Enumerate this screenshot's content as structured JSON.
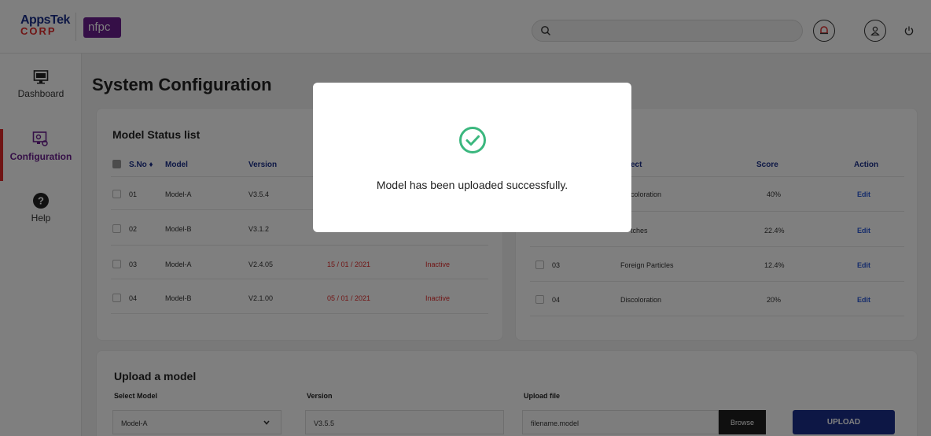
{
  "header": {
    "brand_line1": "AppsTek",
    "brand_line2": "CORP",
    "partner_logo": "nfpc",
    "search_icon": "search-icon",
    "icons": [
      "notification-icon",
      "user-icon",
      "power-icon"
    ]
  },
  "sidebar": {
    "items": [
      {
        "label": "Dashboard",
        "icon": "monitor-icon"
      },
      {
        "label": "Configuration",
        "icon": "config-monitor-icon"
      },
      {
        "label": "Help",
        "icon": "help-icon"
      }
    ]
  },
  "page": {
    "title": "System Configuration"
  },
  "model_status": {
    "title": "Model Status list",
    "columns": [
      "S.No ♦",
      "Model",
      "Version"
    ],
    "rows": [
      {
        "sno": "01",
        "model": "Model-A",
        "version": "V3.5.4",
        "date": "",
        "status": ""
      },
      {
        "sno": "02",
        "model": "Model-B",
        "version": "V3.1.2",
        "date": "",
        "status": ""
      },
      {
        "sno": "03",
        "model": "Model-A",
        "version": "V2.4.05",
        "date": "15 / 01 / 2021",
        "status": "Inactive"
      },
      {
        "sno": "04",
        "model": "Model-B",
        "version": "V2.1.00",
        "date": "05 / 01 / 2021",
        "status": "Inactive"
      }
    ]
  },
  "defects": {
    "columns": [
      "ect",
      "Score",
      "Action"
    ],
    "rows": [
      {
        "sno": "",
        "defect": "coloration",
        "score": "40%",
        "action": "Edit"
      },
      {
        "sno": "",
        "defect": "tches",
        "score": "22.4%",
        "action": "Edit"
      },
      {
        "sno": "03",
        "defect": "Foreign Particles",
        "score": "12.4%",
        "action": "Edit"
      },
      {
        "sno": "04",
        "defect": "Discoloration",
        "score": "20%",
        "action": "Edit"
      }
    ]
  },
  "upload": {
    "title": "Upload a model",
    "select_label": "Select Model",
    "select_value": "Model-A",
    "version_label": "Version",
    "version_value": "V3.5.5",
    "file_label": "Upload file",
    "file_value": "filename.model",
    "browse_label": "Browse",
    "upload_label": "UPLOAD"
  },
  "modal": {
    "icon": "success-check-icon",
    "message": "Model has been uploaded successfully.",
    "accent": "#3bb77e"
  }
}
